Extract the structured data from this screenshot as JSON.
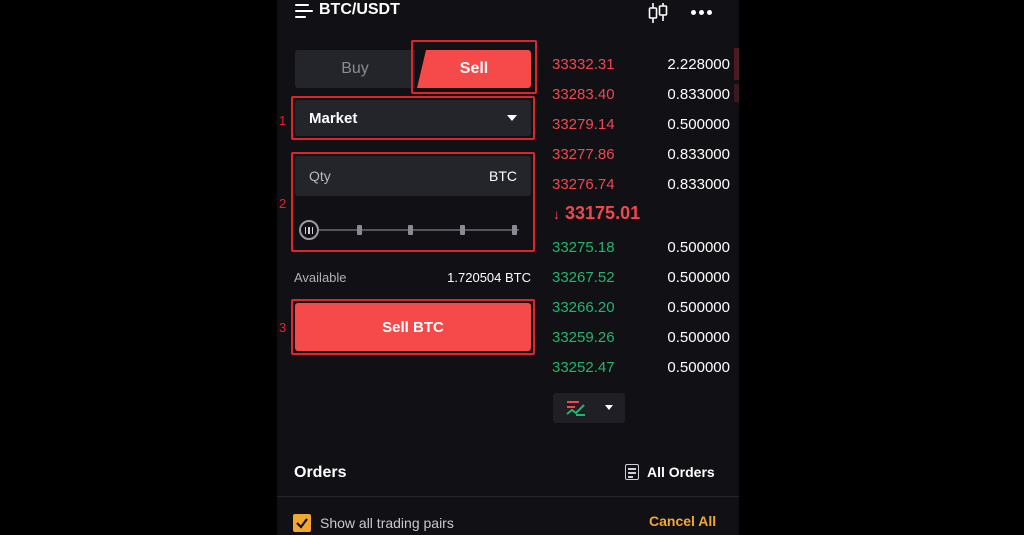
{
  "header": {
    "pair": "BTC/USDT"
  },
  "trade": {
    "buy_label": "Buy",
    "sell_label": "Sell",
    "order_type": "Market",
    "qty_placeholder": "Qty",
    "qty_unit": "BTC",
    "available_label": "Available",
    "available_value": "1.720504 BTC",
    "submit_label": "Sell BTC"
  },
  "annotations": {
    "step_1": "1",
    "step_2": "2",
    "step_3": "3"
  },
  "order_book": {
    "asks": [
      {
        "price": "33332.31",
        "qty": "2.228000"
      },
      {
        "price": "33283.40",
        "qty": "0.833000"
      },
      {
        "price": "33279.14",
        "qty": "0.500000"
      },
      {
        "price": "33277.86",
        "qty": "0.833000"
      },
      {
        "price": "33276.74",
        "qty": "0.833000"
      }
    ],
    "last_price": "33175.01",
    "last_price_arrow": "↓",
    "bids": [
      {
        "price": "33275.18",
        "qty": "0.500000"
      },
      {
        "price": "33267.52",
        "qty": "0.500000"
      },
      {
        "price": "33266.20",
        "qty": "0.500000"
      },
      {
        "price": "33259.26",
        "qty": "0.500000"
      },
      {
        "price": "33252.47",
        "qty": "0.500000"
      }
    ]
  },
  "orders": {
    "title": "Orders",
    "all_orders_label": "All Orders",
    "show_all_label": "Show all trading pairs",
    "cancel_all_label": "Cancel All"
  },
  "colors": {
    "sell_accent": "#f64949",
    "ask_price": "#f0474f",
    "bid_price": "#22b56e",
    "highlight": "#e0242b",
    "checkbox": "#f0a830"
  },
  "icons": {
    "menu": "menu-icon",
    "chart": "candlestick-chart-icon",
    "more": "more-options-icon",
    "depth": "orderbook-depth-icon",
    "orders": "document-icon",
    "check": "checkbox-check-icon"
  }
}
